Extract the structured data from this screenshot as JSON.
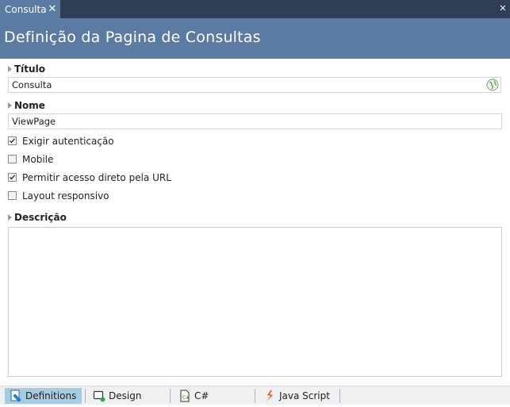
{
  "tab": {
    "title": "Consulta",
    "close_glyph": "✕"
  },
  "window": {
    "close_glyph": "✕"
  },
  "header": {
    "title": "Definição da Pagina de Consultas"
  },
  "titulo": {
    "label": "Título",
    "value": "Consulta",
    "icon": "globe-icon"
  },
  "nome": {
    "label": "Nome",
    "value": "ViewPage"
  },
  "options": [
    {
      "label": "Exigir autenticação",
      "checked": true
    },
    {
      "label": "Mobile",
      "checked": false
    },
    {
      "label": "Permitir acesso direto pela URL",
      "checked": true
    },
    {
      "label": "Layout responsivo",
      "checked": false
    }
  ],
  "descricao": {
    "label": "Descrição",
    "value": ""
  },
  "bottom_tabs": [
    {
      "label": "Definitions",
      "icon": "definitions-icon",
      "active": true
    },
    {
      "label": "Design",
      "icon": "design-icon",
      "active": false
    },
    {
      "label": "C#",
      "icon": "csharp-file-icon",
      "active": false
    },
    {
      "label": "Java Script",
      "icon": "javascript-icon",
      "active": false
    }
  ],
  "colors": {
    "header_bg": "#5b7ba3",
    "tabstrip_bg": "#2f3d55",
    "active_bottom_tab": "#a7cbe0",
    "javascript_icon": "#e8612c",
    "design_dot": "#2fa84a"
  }
}
